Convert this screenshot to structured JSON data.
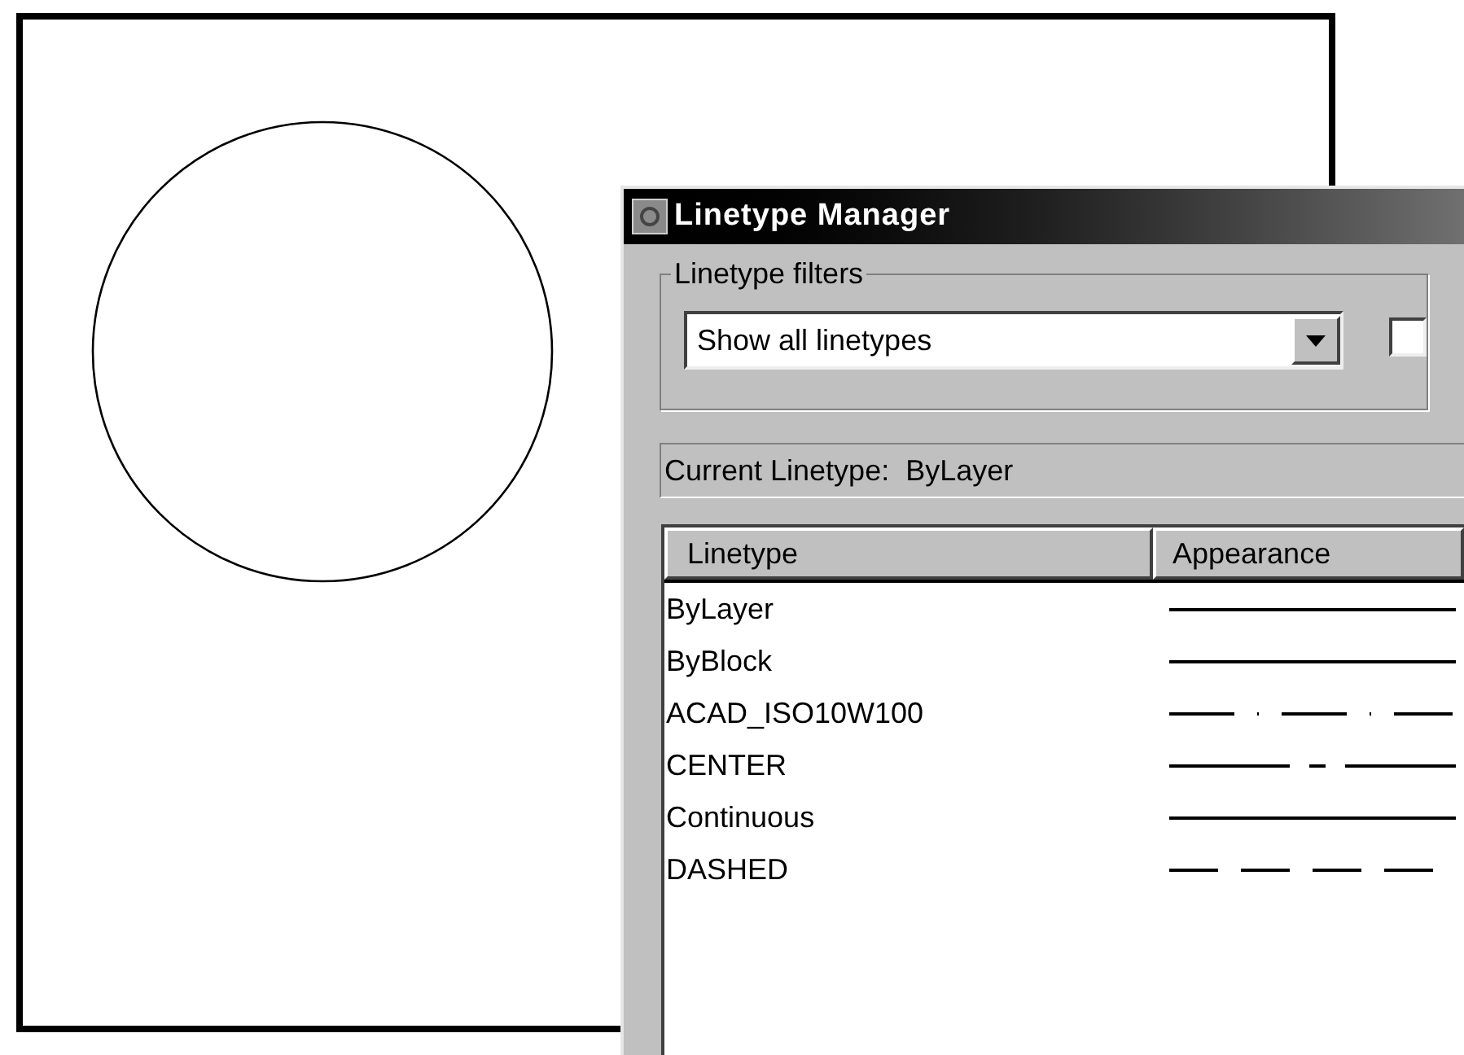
{
  "dialog": {
    "title": "Linetype Manager",
    "filters": {
      "label": "Linetype filters",
      "value": "Show all linetypes",
      "checked": false
    },
    "current": "Current Linetype:  ByLayer",
    "table": {
      "columns": [
        "Linetype",
        "Appearance"
      ],
      "rows": [
        {
          "name": "ByLayer",
          "kind": "continuous"
        },
        {
          "name": "ByBlock",
          "kind": "continuous"
        },
        {
          "name": "ACAD_ISO10W100",
          "kind": "dashdot"
        },
        {
          "name": "CENTER",
          "kind": "center"
        },
        {
          "name": "Continuous",
          "kind": "continuous"
        },
        {
          "name": "DASHED",
          "kind": "dashed"
        }
      ]
    }
  }
}
